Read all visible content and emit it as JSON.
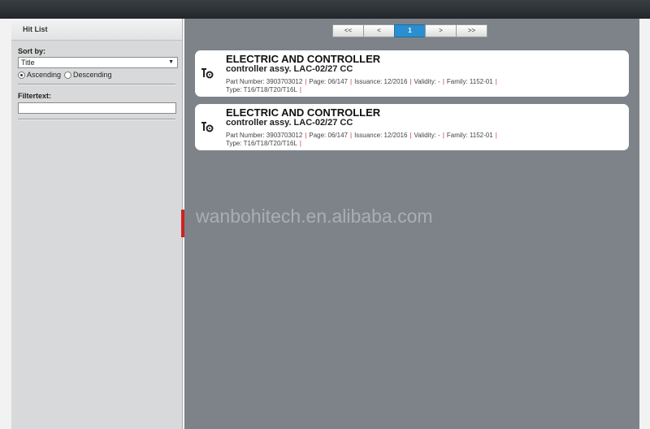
{
  "sidebar": {
    "title": "Hit List",
    "sort_label": "Sort by:",
    "sort_value": "Title",
    "ascending_label": "Ascending",
    "descending_label": "Descending",
    "filter_label": "Filtertext:",
    "filter_value": ""
  },
  "pager": {
    "first": "<<",
    "prev": "<",
    "current": "1",
    "next": ">",
    "last": ">>"
  },
  "results": [
    {
      "title": "ELECTRIC AND CONTROLLER",
      "subtitle": "controller assy.  LAC-02/27 CC",
      "part_number": "Part Number: 3903703012",
      "page": "Page: 06/147",
      "issuance": "Issuance: 12/2016",
      "validity": "Validity:  -",
      "family": "Family: 1152-01",
      "type": "Type: T16/T18/T20/T16L"
    },
    {
      "title": "ELECTRIC AND CONTROLLER",
      "subtitle": "controller assy.  LAC-02/27 CC",
      "part_number": "Part Number: 3903703012",
      "page": "Page: 06/147",
      "issuance": "Issuance: 12/2016",
      "validity": "Validity:  -",
      "family": "Family: 1152-01",
      "type": "Type: T16/T18/T20/T16L"
    }
  ],
  "watermark": "wanbohitech.en.alibaba.com",
  "colors": {
    "accent": "#2a8fd0",
    "content_bg": "#7d8388",
    "sidebar_bg": "#d8d9da",
    "pipe": "#c0392b"
  },
  "icons": {
    "result_icon": "tools-icon"
  }
}
